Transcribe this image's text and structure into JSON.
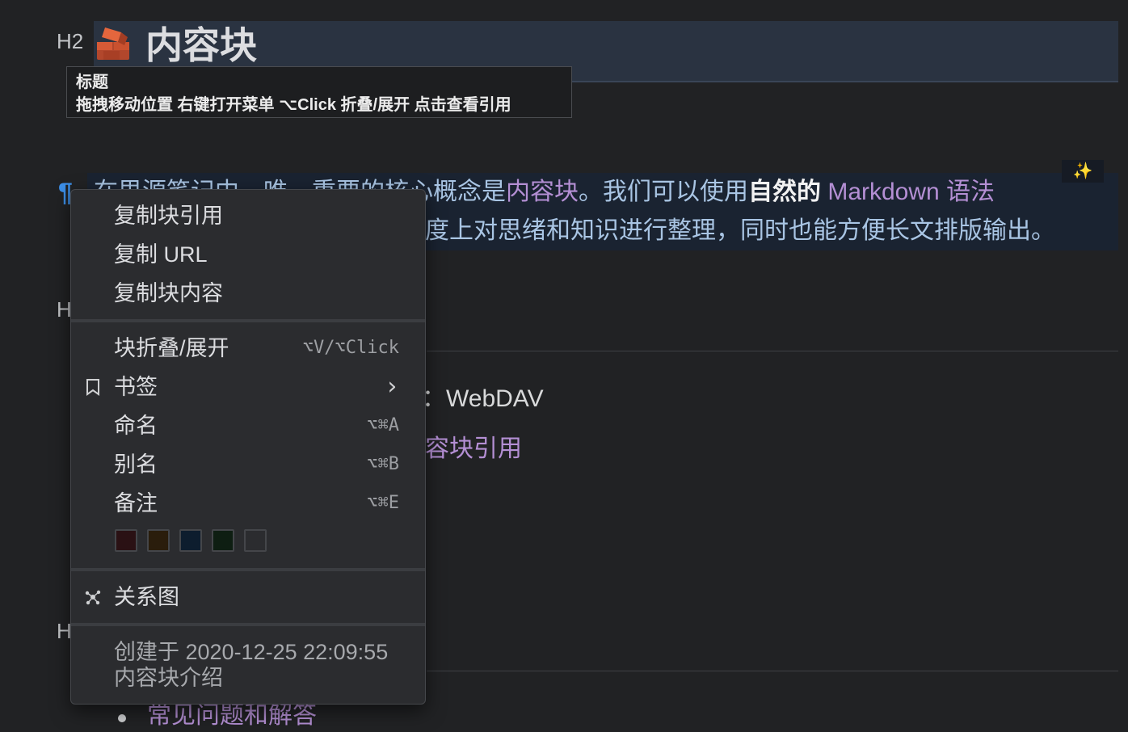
{
  "heading": {
    "marker": "H2",
    "title": "内容块"
  },
  "tooltip": {
    "title": "标题",
    "hint": "拖拽移动位置 右键打开菜单 ⌥Click 折叠/展开 点击查看引用"
  },
  "paragraph": {
    "line1_prefix": "在思源笔记中，唯一重要的核心概念是",
    "line1_link": "内容块",
    "line1_mid": "。我们可以使用",
    "line1_bold": "自然的",
    "line1_link2": " Markdown 语法",
    "line2": "度上对思绪和知识进行整理，同时也能方便长文排版输出。",
    "sparkle": "✨"
  },
  "background": {
    "h_marker_1": "H",
    "h_marker_2": "H",
    "webdav_text": "WebDAV",
    "webdav_prefix": "：",
    "ref_text": "容块引用",
    "faq_link": "常见问题和解答"
  },
  "context_menu": {
    "copy_ref": "复制块引用",
    "copy_url": "复制 URL",
    "copy_content": "复制块内容",
    "fold": {
      "label": "块折叠/展开",
      "shortcut": "⌥V/⌥Click"
    },
    "bookmark": {
      "label": "书签",
      "arrow": "›"
    },
    "rename": {
      "label": "命名",
      "shortcut": "⌥⌘A"
    },
    "alias": {
      "label": "别名",
      "shortcut": "⌥⌘B"
    },
    "memo": {
      "label": "备注",
      "shortcut": "⌥⌘E"
    },
    "colors": [
      "#2a1114",
      "#2a1d0c",
      "#0d1d2e",
      "#0e1e12",
      "#2b2c2f"
    ],
    "graph": "关系图",
    "created": "创建于 2020-12-25 22:09:55",
    "block_memo": "内容块介绍"
  },
  "colors": {
    "accent_blue": "#3c8fe8",
    "link_purple": "#b48fd4",
    "background": "#212224"
  }
}
